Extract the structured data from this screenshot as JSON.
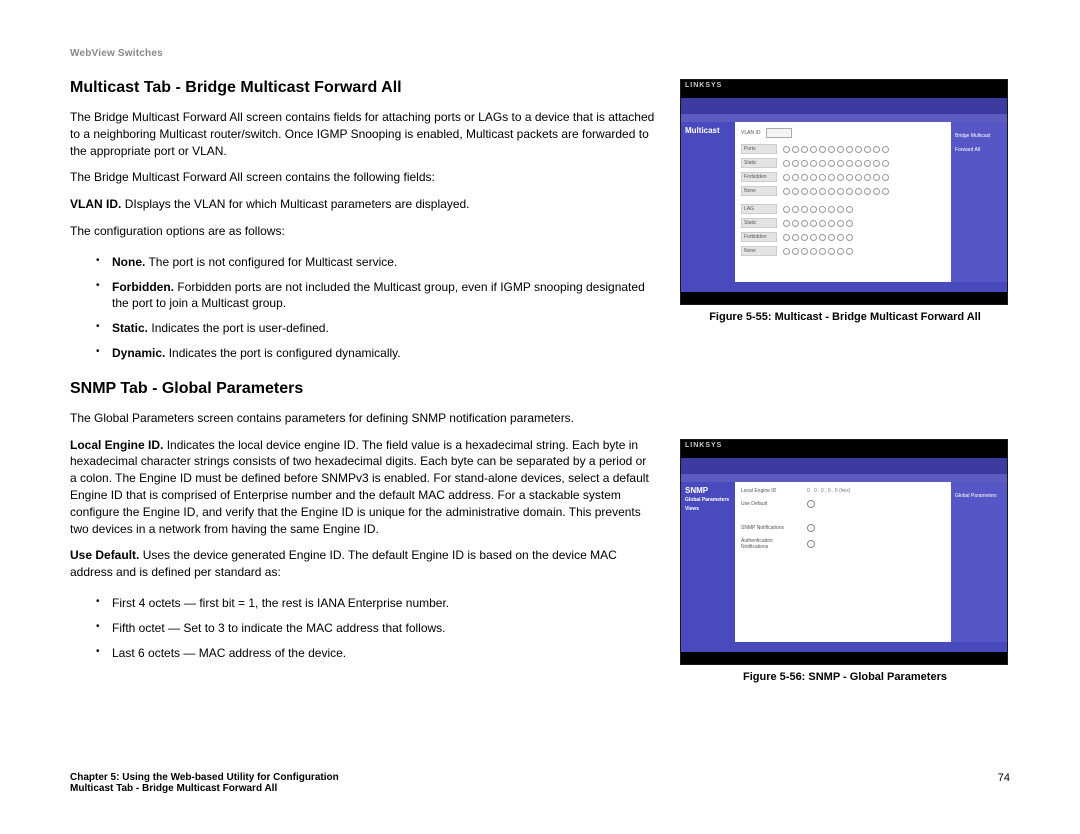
{
  "header": "WebView Switches",
  "sections": {
    "multicast": {
      "title": "Multicast Tab - Bridge Multicast Forward All",
      "intro": "The Bridge Multicast Forward All screen contains fields for attaching ports or LAGs to a device that is attached to a neighboring Multicast router/switch. Once IGMP Snooping is enabled, Multicast packets are forwarded to the appropriate port or VLAN.",
      "fields_intro": "The Bridge Multicast Forward All screen contains the following fields:",
      "vlan_label": "VLAN ID.",
      "vlan_desc": " DIsplays the VLAN for which Multicast parameters are displayed.",
      "opts_intro": "The configuration options are as follows:",
      "opts": {
        "none_label": "None.",
        "none_desc": " The port is not configured for Multicast service.",
        "forbidden_label": "Forbidden.",
        "forbidden_desc": " Forbidden ports are not included the Multicast group, even if IGMP snooping designated the port to join a Multicast group.",
        "static_label": "Static.",
        "static_desc": " Indicates the port is user-defined.",
        "dynamic_label": "Dynamic.",
        "dynamic_desc": " Indicates the port is configured dynamically."
      }
    },
    "snmp": {
      "title": "SNMP Tab - Global Parameters",
      "intro": "The Global Parameters screen contains parameters for defining SNMP notification parameters.",
      "local_label": "Local Engine ID.",
      "local_desc": " Indicates the local device engine ID. The field value is a hexadecimal string. Each byte in hexadecimal character strings consists of two hexadecimal digits. Each byte can be separated by a period or a colon. The Engine ID must be defined before SNMPv3 is enabled. For stand-alone devices, select a default Engine ID that is comprised of Enterprise number and the default MAC address. For a stackable system configure the Engine ID, and verify that the Engine ID is unique for the administrative domain. This prevents two devices in a network from having the same Engine ID.",
      "usedef_label": "Use Default.",
      "usedef_desc": " Uses the device generated Engine ID. The default Engine ID is based on the device MAC address and is defined per standard as:",
      "octets": {
        "o1": "First 4 octets — first bit = 1, the rest is IANA Enterprise number.",
        "o2": "Fifth octet — Set to 3 to indicate the MAC address that follows.",
        "o3": "Last 6 octets — MAC address of the device."
      }
    }
  },
  "figures": {
    "f55": {
      "caption": "Figure 5-55: Multicast - Bridge Multicast Forward All",
      "brand": "LINKSYS",
      "panel_title": "Multicast",
      "right_title": "Bridge Multicast Forward All",
      "vlan_label": "VLAN ID",
      "row_labels": [
        "Ports",
        "Static",
        "Forbidden",
        "None",
        "LAG",
        "Static",
        "Forbidden",
        "None"
      ]
    },
    "f56": {
      "caption": "Figure 5-56: SNMP - Global Parameters",
      "brand": "LINKSYS",
      "panel_title": "SNMP",
      "left_items": [
        "Global Parameters",
        "Views"
      ],
      "right_title": "Global Parameters",
      "rows": {
        "r1_label": "Local Engine ID",
        "r1_val": "0 . 0 . 0 . 0 . 0 (hex)",
        "r2_label": "Use Default",
        "r3_label": "SNMP Notifications",
        "r4_label": "Authentication Notifications"
      }
    }
  },
  "footer": {
    "chapter": "Chapter 5: Using the Web-based Utility for Configuration",
    "sub": "Multicast Tab - Bridge Multicast Forward All",
    "page": "74"
  }
}
